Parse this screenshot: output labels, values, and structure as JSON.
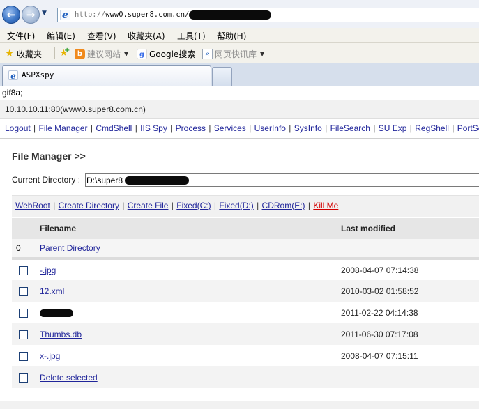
{
  "browser": {
    "address": {
      "protocol": "http://",
      "host": "www0.super8.com.cn/"
    },
    "menu": [
      "文件(F)",
      "编辑(E)",
      "查看(V)",
      "收藏夹(A)",
      "工具(T)",
      "帮助(H)"
    ],
    "favorites_bar": {
      "favorites_label": "收藏夹",
      "items": [
        "建议网站",
        "Google搜索",
        "网页快讯库"
      ]
    },
    "tabs": [
      {
        "label": "ASPXspy",
        "active": true
      }
    ],
    "icons": {
      "back": "back-arrow-icon",
      "forward": "forward-arrow-icon",
      "page": "ie-page-icon",
      "star": "star-icon"
    }
  },
  "page": {
    "header_line": "gif8a;",
    "host": "10.10.10.11:80(www0.super8.com.cn)",
    "nav_links": [
      "Logout",
      "File Manager",
      "CmdShell",
      "IIS Spy",
      "Process",
      "Services",
      "UserInfo",
      "SysInfo",
      "FileSearch",
      "SU Exp",
      "RegShell",
      "PortScan"
    ],
    "file_manager": {
      "title": "File Manager >>",
      "current_directory_label": "Current Directory :",
      "current_directory_value": "D:\\super8",
      "action_links": [
        "WebRoot",
        "Create Directory",
        "Create File",
        "Fixed(C:)",
        "Fixed(D:)",
        "CDRom(E:)"
      ],
      "kill_link": "Kill Me",
      "columns": {
        "filename": "Filename",
        "modified": "Last modified"
      },
      "parent_row": {
        "index": "0",
        "label": "Parent Directory"
      },
      "files": [
        {
          "name": "-.jpg",
          "modified": "2008-04-07 07:14:38",
          "redacted": false
        },
        {
          "name": "12.xml",
          "modified": "2010-03-02 01:58:52",
          "redacted": false
        },
        {
          "name": "",
          "modified": "2011-02-22 04:14:38",
          "redacted": true
        },
        {
          "name": "Thumbs.db",
          "modified": "2011-06-30 07:17:08",
          "redacted": false
        },
        {
          "name": "x-.jpg",
          "modified": "2008-04-07 07:15:11",
          "redacted": false
        }
      ],
      "delete_label": "Delete selected"
    },
    "colors": {
      "link": "#20259a",
      "kill_link": "#d20000",
      "bar_bg": "#f1f1f1"
    }
  }
}
